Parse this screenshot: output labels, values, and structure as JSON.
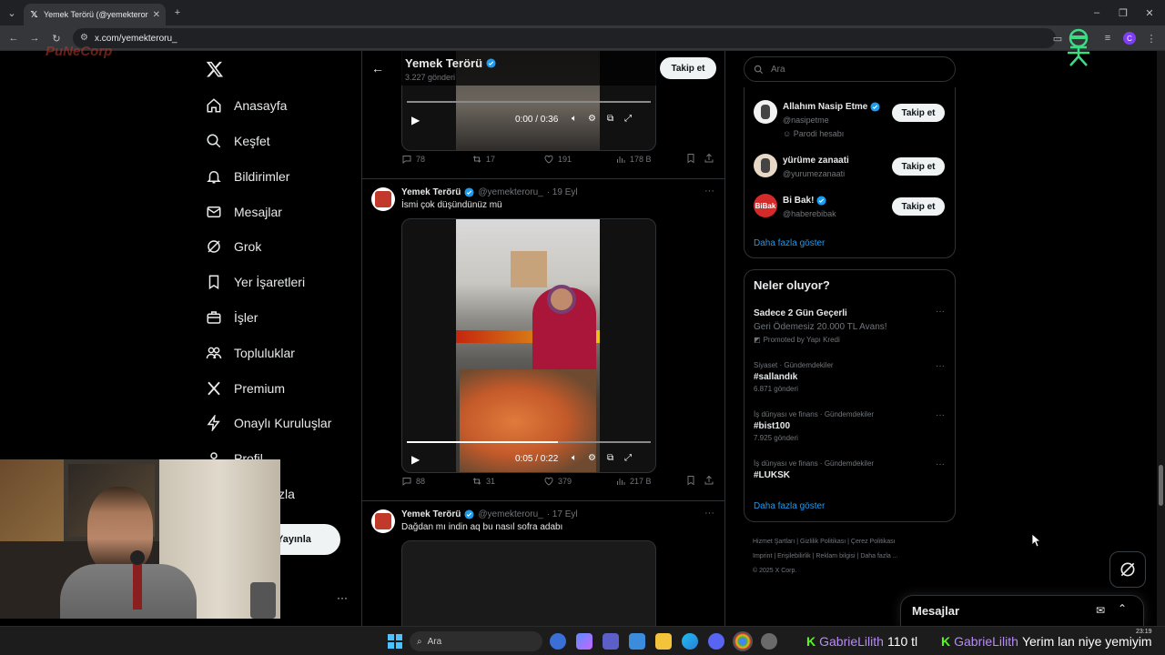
{
  "browser": {
    "tab_title": "Yemek Terörü (@yemekteroru_)",
    "url": "x.com/yemekteroru_",
    "watermark": "PuNeCorp"
  },
  "nav": {
    "items": [
      {
        "label": "Anasayfa",
        "icon": "home-icon"
      },
      {
        "label": "Keşfet",
        "icon": "search-icon"
      },
      {
        "label": "Bildirimler",
        "icon": "bell-icon"
      },
      {
        "label": "Mesajlar",
        "icon": "mail-icon"
      },
      {
        "label": "Grok",
        "icon": "grok-icon"
      },
      {
        "label": "Yer İşaretleri",
        "icon": "bookmark-icon"
      },
      {
        "label": "İşler",
        "icon": "briefcase-icon"
      },
      {
        "label": "Topluluklar",
        "icon": "people-icon"
      },
      {
        "label": "Premium",
        "icon": "x-icon"
      },
      {
        "label": "Onaylı Kuruluşlar",
        "icon": "bolt-icon"
      },
      {
        "label": "Profil",
        "icon": "person-icon"
      },
      {
        "label": "Daha fazla",
        "icon": "more-circle-icon"
      }
    ],
    "post_button": "Yayınla",
    "more_dots": "···"
  },
  "profile_header": {
    "name": "Yemek Terörü",
    "posts": "3.227 gönderi",
    "follow": "Takip et"
  },
  "tweets": [
    {
      "video_time": "0:00 / 0:36",
      "stats": {
        "replies": "78",
        "retweets": "17",
        "likes": "191",
        "views": "178 B"
      }
    },
    {
      "name": "Yemek Terörü",
      "handle": "@yemekteroru_",
      "date": "· 19 Eyl",
      "text": "İsmi çok düşündünüz mü",
      "video_time": "0:05 / 0:22",
      "stats": {
        "replies": "88",
        "retweets": "31",
        "likes": "379",
        "views": "217 B"
      }
    },
    {
      "name": "Yemek Terörü",
      "handle": "@yemekteroru_",
      "date": "· 17 Eyl",
      "text": "Dağdan mı indin aq bu nasıl sofra adabı"
    }
  ],
  "search": {
    "placeholder": "Ara"
  },
  "who_to_follow": {
    "items": [
      {
        "name": "Allahım Nasip Etme",
        "handle": "@nasipetme",
        "extra": "Parodi hesabı",
        "button": "Takip et"
      },
      {
        "name": "yürüme zanaati",
        "handle": "@yurumezanaati",
        "button": "Takip et"
      },
      {
        "name": "Bi Bak!",
        "handle": "@haberebibak",
        "button": "Takip et"
      }
    ],
    "show_more": "Daha fazla göster"
  },
  "trends": {
    "title": "Neler oluyor?",
    "ad": {
      "title": "Sadece 2 Gün Geçerli",
      "subtitle": "Geri Ödemesiz 20.000 TL Avans!",
      "promoted": "Promoted by Yapı Kredi"
    },
    "items": [
      {
        "category": "Siyaset · Gündemdekiler",
        "tag": "#sallandık",
        "count": "6.871 gönderi"
      },
      {
        "category": "İş dünyası ve finans · Gündemdekiler",
        "tag": "#bist100",
        "count": "7.925 gönderi"
      },
      {
        "category": "İş dünyası ve finans · Gündemdekiler",
        "tag": "#LUKSK",
        "count": ""
      }
    ],
    "show_more": "Daha fazla göster"
  },
  "footer": {
    "links1": [
      "Hizmet Şartları",
      "Gizlilik Politikası",
      "Çerez Politikası"
    ],
    "links2": [
      "Imprint",
      "Erişilebilirlik",
      "Reklam bilgisi",
      "Daha fazla ..."
    ],
    "copyright": "© 2025 X Corp."
  },
  "messages_drawer": {
    "title": "Mesajlar"
  },
  "taskbar": {
    "search": "Ara",
    "clock": "23:19",
    "chat1_user": "GabrieLilith",
    "chat1_text": "110 tl",
    "chat2_user": "GabrieLilith",
    "chat2_text": "Yerim lan niye yemiyim"
  },
  "colors": {
    "accent": "#1d9bf0",
    "bg": "#000000",
    "border": "#2f3336",
    "chat_name": "#b78bf8",
    "chat_k": "#53fc18"
  }
}
